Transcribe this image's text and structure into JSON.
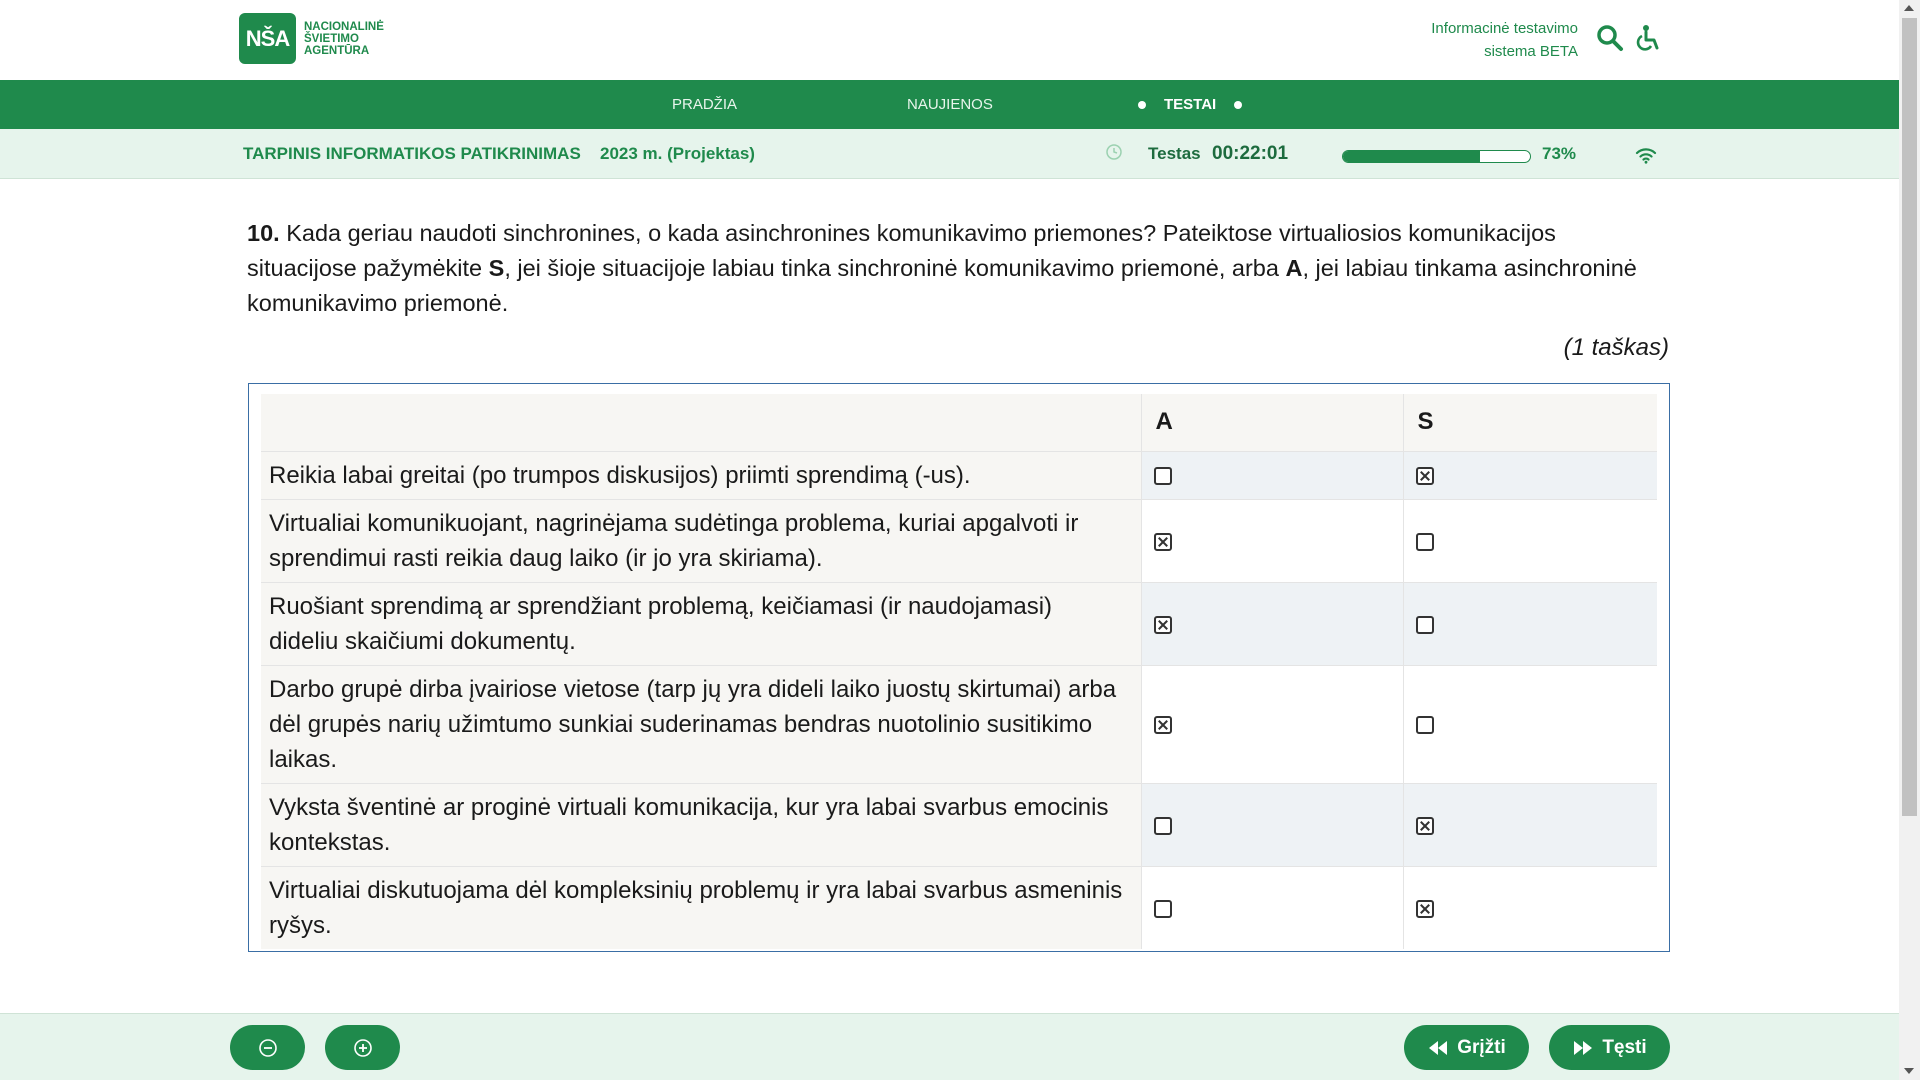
{
  "header": {
    "logo_mark": "NŠA",
    "logo_lines": [
      "NACIONALINĖ",
      "ŠVIETIMO",
      "AGENTŪRA"
    ],
    "system_name_line1": "Informacinė testavimo",
    "system_name_line2": "sistema BETA",
    "search_icon": "search-icon",
    "accessibility_icon": "accessibility-icon"
  },
  "nav": {
    "items": [
      {
        "label": "PRADŽIA"
      },
      {
        "label": "NAUJIENOS"
      },
      {
        "label": "TESTAI",
        "active": true
      }
    ]
  },
  "subbar": {
    "title": "TARPINIS INFORMATIKOS PATIKRINIMAS",
    "year": "2023 m. (Projektas)",
    "test_label": "Testas",
    "timer": "00:22:01",
    "progress_fraction": 0.73,
    "progress_text": "73%"
  },
  "question": {
    "number": "10.",
    "text_1": " Kada geriau naudoti sinchronines, o kada asinchronines komunikavimo priemones? Pateiktose virtualiosios komunikacijos situacijose pažymėkite ",
    "bold_s": "S",
    "text_2": ", jei šioje situacijoje labiau tinka sinchroninė komunikavimo priemonė, arba ",
    "bold_a": "A",
    "text_3": ", jei labiau tinkama asinchroninė komunikavimo priemonė.",
    "points": "(1 taškas)"
  },
  "table": {
    "headers": [
      "",
      "A",
      "S"
    ],
    "rows": [
      {
        "text": "Reikia labai greitai (po trumpos diskusijos) priimti sprendimą (-us).",
        "a": false,
        "s": true
      },
      {
        "text": "Virtualiai komunikuojant, nagrinėjama sudėtinga problema, kuriai apgalvoti ir sprendimui rasti reikia daug laiko (ir jo yra skiriama).",
        "a": true,
        "s": false
      },
      {
        "text": "Ruošiant sprendimą ar sprendžiant problemą, keičiamasi (ir naudojamasi) dideliu skaičiumi dokumentų.",
        "a": true,
        "s": false
      },
      {
        "text": "Darbo grupė dirba įvairiose vietose (tarp jų yra dideli laiko juostų skirtumai) arba dėl grupės narių užimtumo sunkiai suderinamas bendras nuotolinio susitikimo laikas.",
        "a": true,
        "s": false
      },
      {
        "text": "Vyksta šventinė ar proginė virtuali komunikacija, kur yra labai svarbus emocinis kontekstas.",
        "a": false,
        "s": true
      },
      {
        "text": "Virtualiai diskutuojama dėl kompleksinių problemų ir yra labai svarbus asmeninis ryšys.",
        "a": false,
        "s": true
      }
    ]
  },
  "footer": {
    "zoom_out_icon": "zoom-out-icon",
    "zoom_in_icon": "zoom-in-icon",
    "back_label": "Grįžti",
    "next_label": "Tęsti"
  },
  "colors": {
    "brand_green": "#1f8a4c",
    "subbar_bg": "#e6f4ec",
    "table_border": "#3a6ea5"
  }
}
